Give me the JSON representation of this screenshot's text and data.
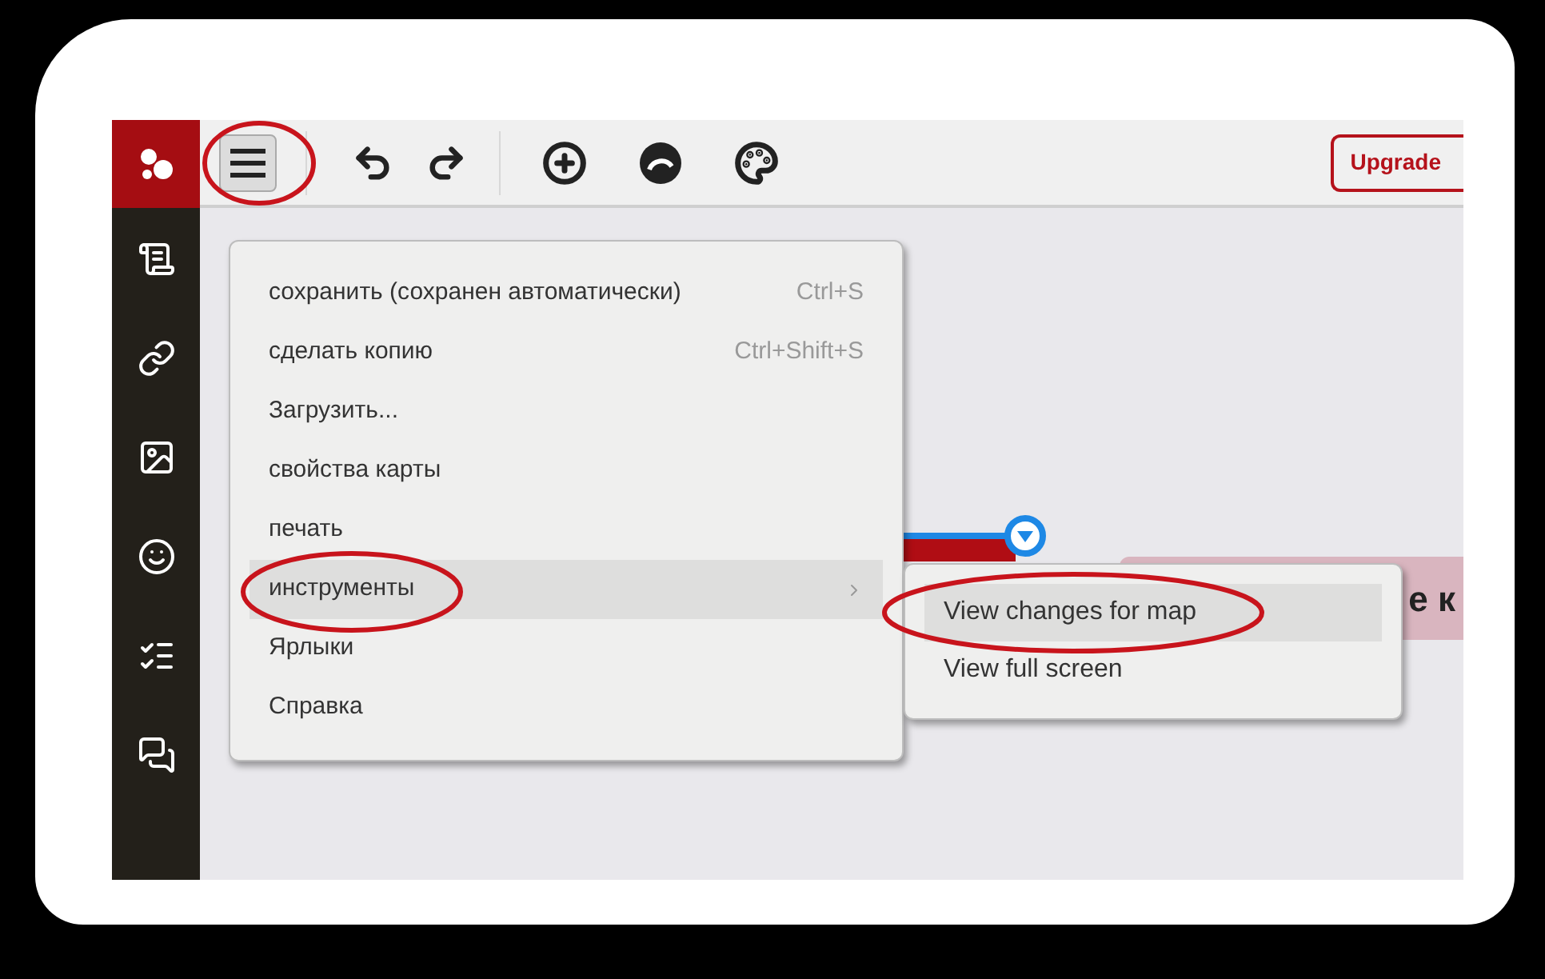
{
  "toolbar": {
    "menu_open": true,
    "upgrade_button": "Upgrade"
  },
  "menu": {
    "items": [
      {
        "label": "сохранить (сохранен автоматически)",
        "shortcut": "Ctrl+S",
        "selected": false,
        "has_submenu": false
      },
      {
        "label": "сделать копию",
        "shortcut": "Ctrl+Shift+S",
        "selected": false,
        "has_submenu": false
      },
      {
        "label": "Загрузить...",
        "selected": false,
        "has_submenu": false
      },
      {
        "label": "свойства карты",
        "selected": false,
        "has_submenu": false
      },
      {
        "label": "печать",
        "selected": false,
        "has_submenu": false
      },
      {
        "label": "инструменты",
        "selected": true,
        "has_submenu": true
      },
      {
        "label": "Ярлыки",
        "selected": false,
        "has_submenu": false
      },
      {
        "label": "Справка",
        "selected": false,
        "has_submenu": false
      }
    ]
  },
  "submenu": {
    "items": [
      {
        "label": "View changes for map",
        "selected": true
      },
      {
        "label": "View full screen",
        "selected": false
      }
    ]
  },
  "map": {
    "node_text": "е к"
  }
}
